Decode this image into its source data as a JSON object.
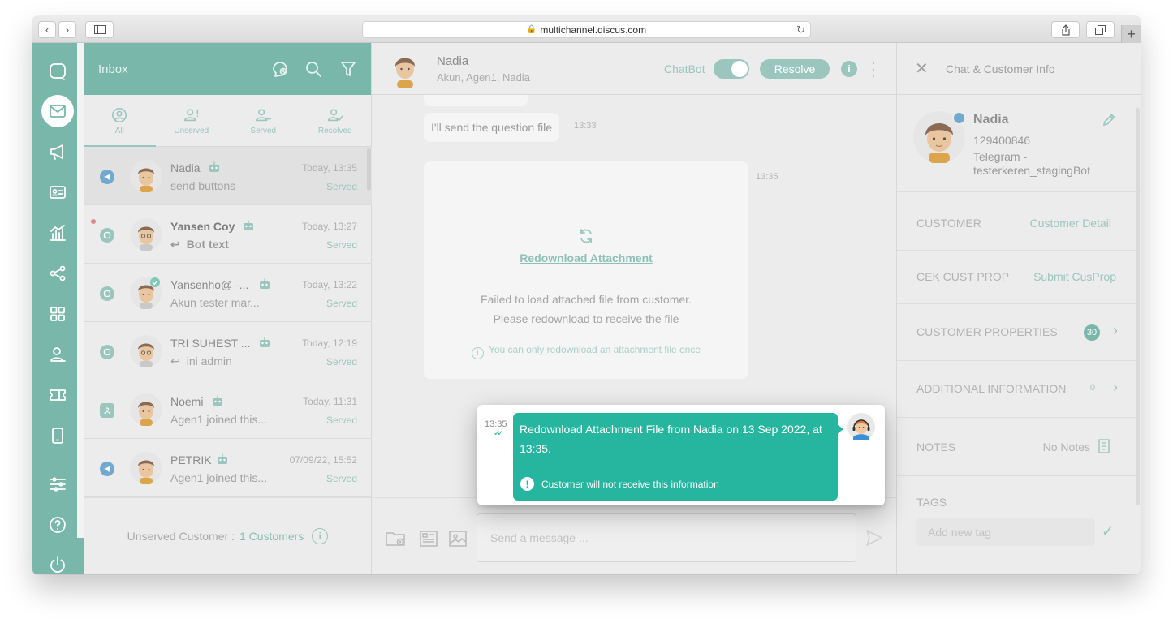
{
  "browser": {
    "url": "multichannel.qiscus.com",
    "back_label": "‹",
    "forward_label": "›",
    "new_tab_label": "+"
  },
  "inbox": {
    "title": "Inbox",
    "tabs": [
      {
        "label": "All"
      },
      {
        "label": "Unserved"
      },
      {
        "label": "Served"
      },
      {
        "label": "Resolved"
      }
    ],
    "conversations": [
      {
        "name": "Nadia",
        "time": "Today, 13:35",
        "preview": "send buttons",
        "status": "Served",
        "channel": "telegram",
        "bold": false
      },
      {
        "name": "Yansen Coy",
        "time": "Today, 13:27",
        "preview": "Bot text",
        "status": "Served",
        "channel": "qiscus",
        "bold": true,
        "reply_arrow": "↩"
      },
      {
        "name": "Yansenho@ -...",
        "time": "Today, 13:22",
        "preview": "Akun tester mar...",
        "status": "Served",
        "channel": "qiscus",
        "bold": false
      },
      {
        "name": "TRI SUHEST ...",
        "time": "Today, 12:19",
        "preview": "ini admin",
        "status": "Served",
        "channel": "qiscus",
        "bold": false,
        "reply_arrow": "↩"
      },
      {
        "name": "Noemi",
        "time": "Today, 11:31",
        "preview": "Agen1 joined this...",
        "status": "Served",
        "channel": "custom",
        "bold": false
      },
      {
        "name": "PETRIK",
        "time": "07/09/22, 15:52",
        "preview": "Agen1 joined this...",
        "status": "Served",
        "channel": "telegram",
        "bold": false
      }
    ],
    "footer_label": "Unserved Customer :",
    "footer_count": "1 Customers",
    "footer_info": "i"
  },
  "chat": {
    "name": "Nadia",
    "participants": "Akun, Agen1, Nadia",
    "chatbot_label": "ChatBot",
    "chatbot_on": true,
    "resolve_label": "Resolve",
    "info_label": "i",
    "messages": {
      "question_text": "I'll send the question file",
      "question_time": "13:33",
      "attachment_time": "13:35",
      "redownload_label": "Redownload Attachment",
      "fail_line1": "Failed to load attached file from customer.",
      "fail_line2": "Please redownload to receive the file",
      "once_note": "You can only redownload an attachment file once",
      "once_icon": "i"
    },
    "composer_placeholder": "Send a message ..."
  },
  "info_panel": {
    "title": "Chat & Customer Info",
    "close_label": "✕",
    "customer": {
      "name": "Nadia",
      "id": "129400846",
      "channel_line1": "Telegram -",
      "channel_line2": "testerkeren_stagingBot"
    },
    "rows": {
      "customer_label": "CUSTOMER",
      "customer_value": "Customer Detail",
      "cek_label": "CEK CUST PROP",
      "cek_value": "Submit CusProp",
      "props_label": "CUSTOMER PROPERTIES",
      "props_count": "30",
      "additional_label": "ADDITIONAL INFORMATION",
      "additional_count": "0",
      "notes_label": "NOTES",
      "notes_value": "No Notes",
      "tags_label": "TAGS"
    },
    "tag_placeholder": "Add new tag",
    "tag_check": "✓",
    "chevron": "›"
  },
  "popup": {
    "time": "13:35",
    "ticks": "✓✓",
    "text": "Redownload Attachment File from Nadia on 13 Sep 2022, at 13:35.",
    "note": "Customer will not receive this information",
    "note_icon": "!"
  },
  "colors": {
    "brand": "#7ab7ab",
    "accent": "#26b59e",
    "telegram": "#72a9d0"
  }
}
